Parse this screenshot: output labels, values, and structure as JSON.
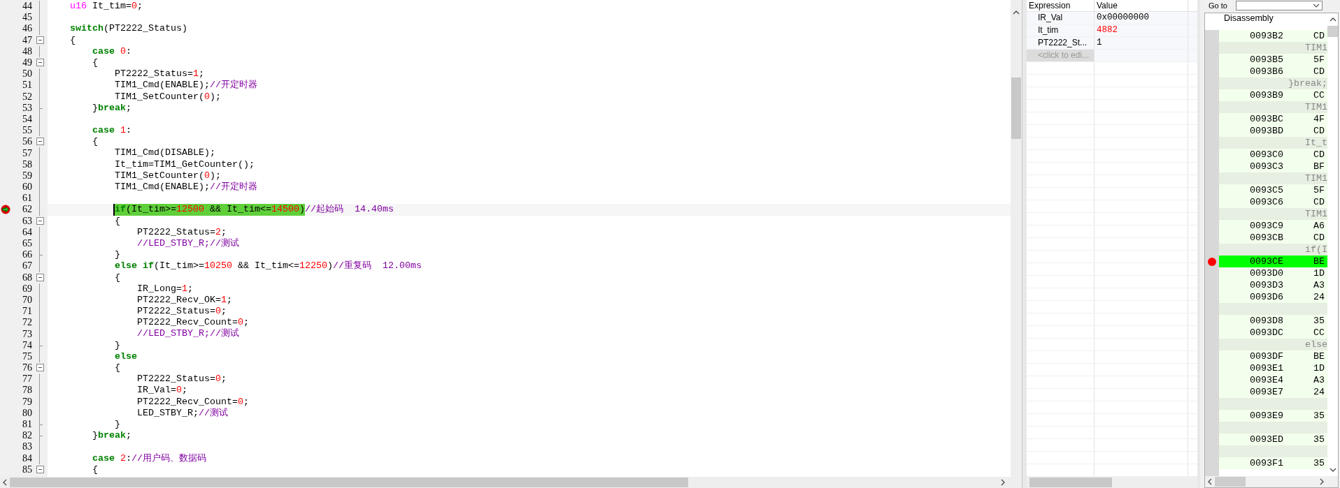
{
  "editor": {
    "lines": [
      {
        "number": "44",
        "foldable": false,
        "fold_end": false,
        "current": false,
        "tokens": [
          {
            "text": "u16",
            "kind": "type"
          },
          {
            "text": " It_tim=",
            "kind": "plain"
          },
          {
            "text": "0",
            "kind": "number"
          },
          {
            "text": ";",
            "kind": "plain"
          }
        ]
      },
      {
        "number": "45",
        "foldable": false,
        "fold_end": false,
        "current": false
      },
      {
        "number": "46",
        "foldable": false,
        "fold_end": false,
        "current": false,
        "tokens": [
          {
            "text": "switch",
            "kind": "keyword"
          },
          {
            "text": "(PT2222_Status)",
            "kind": "plain"
          }
        ]
      },
      {
        "number": "47",
        "foldable": true,
        "fold_end": false,
        "current": false,
        "tokens": [
          {
            "text": "{",
            "kind": "plain"
          }
        ],
        "children": [
          {
            "number": "48",
            "foldable": false,
            "fold_end": false,
            "current": false,
            "tokens": [
              {
                "text": "case ",
                "kind": "keyword"
              },
              {
                "text": "0",
                "kind": "number"
              },
              {
                "text": ":",
                "kind": "plain"
              }
            ]
          },
          {
            "number": "49",
            "foldable": true,
            "fold_end": false,
            "current": false,
            "tokens": [
              {
                "text": "{",
                "kind": "plain"
              }
            ],
            "children": [
              {
                "number": "50",
                "foldable": false,
                "fold_end": false,
                "current": false,
                "tokens": [
                  {
                    "text": "PT2222_Status=",
                    "kind": "plain"
                  },
                  {
                    "text": "1",
                    "kind": "number"
                  },
                  {
                    "text": ";",
                    "kind": "plain"
                  }
                ]
              },
              {
                "number": "51",
                "foldable": false,
                "fold_end": false,
                "current": false,
                "tokens": [
                  {
                    "text": "TIM1_Cmd(ENABLE);",
                    "kind": "plain"
                  },
                  {
                    "text": "//开定时器",
                    "kind": "comment"
                  }
                ]
              },
              {
                "number": "52",
                "foldable": false,
                "fold_end": false,
                "current": false,
                "tokens": [
                  {
                    "text": "TIM1_SetCounter(",
                    "kind": "plain"
                  },
                  {
                    "text": "0",
                    "kind": "number"
                  },
                  {
                    "text": ");",
                    "kind": "plain"
                  }
                ]
              }
            ]
          },
          {
            "number": "53",
            "foldable": false,
            "fold_end": true,
            "current": false,
            "tokens": [
              {
                "text": "}",
                "kind": "plain"
              },
              {
                "text": "break",
                "kind": "keyword"
              },
              {
                "text": ";",
                "kind": "plain"
              }
            ]
          },
          {
            "number": "54",
            "foldable": false,
            "fold_end": false,
            "current": false
          },
          {
            "number": "55",
            "foldable": false,
            "fold_end": false,
            "current": false,
            "tokens": [
              {
                "text": "case ",
                "kind": "keyword"
              },
              {
                "text": "1",
                "kind": "number"
              },
              {
                "text": ":",
                "kind": "plain"
              }
            ]
          },
          {
            "number": "56",
            "foldable": true,
            "fold_end": false,
            "current": false,
            "tokens": [
              {
                "text": "{",
                "kind": "plain"
              }
            ],
            "children": [
              {
                "number": "57",
                "foldable": false,
                "fold_end": false,
                "current": false,
                "tokens": [
                  {
                    "text": "TIM1_Cmd(DISABLE);",
                    "kind": "plain"
                  }
                ]
              },
              {
                "number": "58",
                "foldable": false,
                "fold_end": false,
                "current": false,
                "tokens": [
                  {
                    "text": "It_tim=TIM1_GetCounter();",
                    "kind": "plain"
                  }
                ]
              },
              {
                "number": "59",
                "foldable": false,
                "fold_end": false,
                "current": false,
                "tokens": [
                  {
                    "text": "TIM1_SetCounter(",
                    "kind": "plain"
                  },
                  {
                    "text": "0",
                    "kind": "number"
                  },
                  {
                    "text": ");",
                    "kind": "plain"
                  }
                ]
              },
              {
                "number": "60",
                "foldable": false,
                "fold_end": false,
                "current": false,
                "tokens": [
                  {
                    "text": "TIM1_Cmd(ENABLE);",
                    "kind": "plain"
                  },
                  {
                    "text": "//开定时器",
                    "kind": "comment"
                  }
                ]
              },
              {
                "number": "61",
                "foldable": false,
                "fold_end": false,
                "current": false
              },
              {
                "number": "62",
                "foldable": false,
                "fold_end": false,
                "current": true,
                "statement": [
                  {
                    "text": "if",
                    "kind": "keyword"
                  },
                  {
                    "text": "(It_tim>=",
                    "kind": "plain"
                  },
                  {
                    "text": "12500",
                    "kind": "number"
                  },
                  {
                    "text": " && It_tim<=",
                    "kind": "plain"
                  },
                  {
                    "text": "14500",
                    "kind": "number"
                  },
                  {
                    "text": ")",
                    "kind": "plain"
                  }
                ],
                "after": [
                  {
                    "text": "//起始码  14.40ms",
                    "kind": "comment"
                  }
                ]
              },
              {
                "number": "63",
                "foldable": true,
                "fold_end": false,
                "current": false,
                "tokens": [
                  {
                    "text": "{",
                    "kind": "plain"
                  }
                ],
                "children": [
                  {
                    "number": "64",
                    "foldable": false,
                    "fold_end": false,
                    "current": false,
                    "tokens": [
                      {
                        "text": "PT2222_Status=",
                        "kind": "plain"
                      },
                      {
                        "text": "2",
                        "kind": "number"
                      },
                      {
                        "text": ";",
                        "kind": "plain"
                      }
                    ]
                  },
                  {
                    "number": "65",
                    "foldable": false,
                    "fold_end": false,
                    "current": false,
                    "tokens": [
                      {
                        "text": "//LED_STBY_R;//测试",
                        "kind": "comment"
                      }
                    ]
                  }
                ]
              },
              {
                "number": "66",
                "foldable": false,
                "fold_end": true,
                "current": false,
                "tokens": [
                  {
                    "text": "}",
                    "kind": "plain"
                  }
                ]
              },
              {
                "number": "67",
                "foldable": false,
                "fold_end": false,
                "current": false,
                "tokens": [
                  {
                    "text": "else if",
                    "kind": "keyword"
                  },
                  {
                    "text": "(It_tim>=",
                    "kind": "plain"
                  },
                  {
                    "text": "10250",
                    "kind": "number"
                  },
                  {
                    "text": " && It_tim<=",
                    "kind": "plain"
                  },
                  {
                    "text": "12250",
                    "kind": "number"
                  },
                  {
                    "text": ")",
                    "kind": "plain"
                  },
                  {
                    "text": "//重复码  12.00ms",
                    "kind": "comment"
                  }
                ]
              },
              {
                "number": "68",
                "foldable": true,
                "fold_end": false,
                "current": false,
                "tokens": [
                  {
                    "text": "{",
                    "kind": "plain"
                  }
                ],
                "children": [
                  {
                    "number": "69",
                    "foldable": false,
                    "fold_end": false,
                    "current": false,
                    "tokens": [
                      {
                        "text": "IR_Long=",
                        "kind": "plain"
                      },
                      {
                        "text": "1",
                        "kind": "number"
                      },
                      {
                        "text": ";",
                        "kind": "plain"
                      }
                    ]
                  },
                  {
                    "number": "70",
                    "foldable": false,
                    "fold_end": false,
                    "current": false,
                    "tokens": [
                      {
                        "text": "PT2222_Recv_OK=",
                        "kind": "plain"
                      },
                      {
                        "text": "1",
                        "kind": "number"
                      },
                      {
                        "text": ";",
                        "kind": "plain"
                      }
                    ]
                  },
                  {
                    "number": "71",
                    "foldable": false,
                    "fold_end": false,
                    "current": false,
                    "tokens": [
                      {
                        "text": "PT2222_Status=",
                        "kind": "plain"
                      },
                      {
                        "text": "0",
                        "kind": "number"
                      },
                      {
                        "text": ";",
                        "kind": "plain"
                      }
                    ]
                  },
                  {
                    "number": "72",
                    "foldable": false,
                    "fold_end": false,
                    "current": false,
                    "tokens": [
                      {
                        "text": "PT2222_Recv_Count=",
                        "kind": "plain"
                      },
                      {
                        "text": "0",
                        "kind": "number"
                      },
                      {
                        "text": ";",
                        "kind": "plain"
                      }
                    ]
                  },
                  {
                    "number": "73",
                    "foldable": false,
                    "fold_end": false,
                    "current": false,
                    "tokens": [
                      {
                        "text": "//LED_STBY_R;//测试",
                        "kind": "comment"
                      }
                    ]
                  }
                ]
              },
              {
                "number": "74",
                "foldable": false,
                "fold_end": true,
                "current": false,
                "tokens": [
                  {
                    "text": "}",
                    "kind": "plain"
                  }
                ]
              },
              {
                "number": "75",
                "foldable": false,
                "fold_end": false,
                "current": false,
                "tokens": [
                  {
                    "text": "else",
                    "kind": "keyword"
                  }
                ]
              },
              {
                "number": "76",
                "foldable": true,
                "fold_end": false,
                "current": false,
                "tokens": [
                  {
                    "text": "{",
                    "kind": "plain"
                  }
                ],
                "children": [
                  {
                    "number": "77",
                    "foldable": false,
                    "fold_end": false,
                    "current": false,
                    "tokens": [
                      {
                        "text": "PT2222_Status=",
                        "kind": "plain"
                      },
                      {
                        "text": "0",
                        "kind": "number"
                      },
                      {
                        "text": ";",
                        "kind": "plain"
                      }
                    ]
                  },
                  {
                    "number": "78",
                    "foldable": false,
                    "fold_end": false,
                    "current": false,
                    "tokens": [
                      {
                        "text": "IR_Val=",
                        "kind": "plain"
                      },
                      {
                        "text": "0",
                        "kind": "number"
                      },
                      {
                        "text": ";",
                        "kind": "plain"
                      }
                    ]
                  },
                  {
                    "number": "79",
                    "foldable": false,
                    "fold_end": false,
                    "current": false,
                    "tokens": [
                      {
                        "text": "PT2222_Recv_Count=",
                        "kind": "plain"
                      },
                      {
                        "text": "0",
                        "kind": "number"
                      },
                      {
                        "text": ";",
                        "kind": "plain"
                      }
                    ]
                  },
                  {
                    "number": "80",
                    "foldable": false,
                    "fold_end": false,
                    "current": false,
                    "tokens": [
                      {
                        "text": "LED_STBY_R;",
                        "kind": "plain"
                      },
                      {
                        "text": "//测试",
                        "kind": "comment"
                      }
                    ]
                  }
                ]
              },
              {
                "number": "81",
                "foldable": false,
                "fold_end": true,
                "current": false,
                "tokens": [
                  {
                    "text": "}",
                    "kind": "plain"
                  }
                ]
              }
            ]
          },
          {
            "number": "82",
            "foldable": false,
            "fold_end": true,
            "current": false,
            "tokens": [
              {
                "text": "}",
                "kind": "plain"
              },
              {
                "text": "break",
                "kind": "keyword"
              },
              {
                "text": ";",
                "kind": "plain"
              }
            ]
          },
          {
            "number": "83",
            "foldable": false,
            "fold_end": false,
            "current": false
          },
          {
            "number": "84",
            "foldable": false,
            "fold_end": false,
            "current": false,
            "tokens": [
              {
                "text": "case ",
                "kind": "keyword"
              },
              {
                "text": "2",
                "kind": "number"
              },
              {
                "text": ":",
                "kind": "plain"
              },
              {
                "text": "//用户码、数据码",
                "kind": "comment"
              }
            ]
          },
          {
            "number": "85",
            "foldable": true,
            "fold_end": false,
            "current": false,
            "tokens": [
              {
                "text": "{",
                "kind": "plain"
              }
            ]
          }
        ]
      }
    ]
  },
  "watch": {
    "columns": [
      "Expression",
      "Value"
    ],
    "rows": [
      {
        "expression": "IR_Val",
        "value": "0x00000000",
        "changed": false
      },
      {
        "expression": "It_tim",
        "value": "4882",
        "changed": true
      },
      {
        "expression": "PT2222_St...",
        "value": "1",
        "changed": false
      }
    ],
    "placeholder": "<click to edi..."
  },
  "disassembly": {
    "goto_label": "Go to",
    "title": "Disassembly",
    "rows": [
      {
        "kind": "code",
        "address": "0093B2",
        "opcode": "CD",
        "current": false,
        "breakpoint": false
      },
      {
        "kind": "source",
        "text": "TIM1",
        "current": false,
        "breakpoint": false
      },
      {
        "kind": "code",
        "address": "0093B5",
        "opcode": "5F",
        "current": false,
        "breakpoint": false
      },
      {
        "kind": "code",
        "address": "0093B6",
        "opcode": "CD",
        "current": false,
        "breakpoint": false
      },
      {
        "kind": "source",
        "text": "}break;",
        "current": false,
        "breakpoint": false
      },
      {
        "kind": "code",
        "address": "0093B9",
        "opcode": "CC",
        "current": false,
        "breakpoint": false
      },
      {
        "kind": "source",
        "text": "TIM1",
        "current": false,
        "breakpoint": false
      },
      {
        "kind": "code",
        "address": "0093BC",
        "opcode": "4F",
        "current": false,
        "breakpoint": false
      },
      {
        "kind": "code",
        "address": "0093BD",
        "opcode": "CD",
        "current": false,
        "breakpoint": false
      },
      {
        "kind": "source",
        "text": "It_t",
        "current": false,
        "breakpoint": false
      },
      {
        "kind": "code",
        "address": "0093C0",
        "opcode": "CD",
        "current": false,
        "breakpoint": false
      },
      {
        "kind": "code",
        "address": "0093C3",
        "opcode": "BF",
        "current": false,
        "breakpoint": false
      },
      {
        "kind": "source",
        "text": "TIM1",
        "current": false,
        "breakpoint": false
      },
      {
        "kind": "code",
        "address": "0093C5",
        "opcode": "5F",
        "current": false,
        "breakpoint": false
      },
      {
        "kind": "code",
        "address": "0093C6",
        "opcode": "CD",
        "current": false,
        "breakpoint": false
      },
      {
        "kind": "source",
        "text": "TIM1",
        "current": false,
        "breakpoint": false
      },
      {
        "kind": "code",
        "address": "0093C9",
        "opcode": "A6",
        "current": false,
        "breakpoint": false
      },
      {
        "kind": "code",
        "address": "0093CB",
        "opcode": "CD",
        "current": false,
        "breakpoint": false
      },
      {
        "kind": "source",
        "text": "if(I",
        "current": false,
        "breakpoint": false
      },
      {
        "kind": "code",
        "address": "0093CE",
        "opcode": "BE",
        "current": true,
        "breakpoint": true
      },
      {
        "kind": "code",
        "address": "0093D0",
        "opcode": "1D",
        "current": false,
        "breakpoint": false
      },
      {
        "kind": "code",
        "address": "0093D3",
        "opcode": "A3",
        "current": false,
        "breakpoint": false
      },
      {
        "kind": "code",
        "address": "0093D6",
        "opcode": "24",
        "current": false,
        "breakpoint": false
      },
      {
        "kind": "source",
        "current": false,
        "breakpoint": false
      },
      {
        "kind": "code",
        "address": "0093D8",
        "opcode": "35",
        "current": false,
        "breakpoint": false
      },
      {
        "kind": "code",
        "address": "0093DC",
        "opcode": "CC",
        "current": false,
        "breakpoint": false
      },
      {
        "kind": "source",
        "text": "else",
        "current": false,
        "breakpoint": false
      },
      {
        "kind": "code",
        "address": "0093DF",
        "opcode": "BE",
        "current": false,
        "breakpoint": false
      },
      {
        "kind": "code",
        "address": "0093E1",
        "opcode": "1D",
        "current": false,
        "breakpoint": false
      },
      {
        "kind": "code",
        "address": "0093E4",
        "opcode": "A3",
        "current": false,
        "breakpoint": false
      },
      {
        "kind": "code",
        "address": "0093E7",
        "opcode": "24",
        "current": false,
        "breakpoint": false
      },
      {
        "kind": "source",
        "current": false,
        "breakpoint": false
      },
      {
        "kind": "code",
        "address": "0093E9",
        "opcode": "35",
        "current": false,
        "breakpoint": false
      },
      {
        "kind": "source",
        "current": false,
        "breakpoint": false
      },
      {
        "kind": "code",
        "address": "0093ED",
        "opcode": "35",
        "current": false,
        "breakpoint": false
      },
      {
        "kind": "source",
        "current": false,
        "breakpoint": false
      },
      {
        "kind": "code",
        "address": "0093F1",
        "opcode": "35",
        "current": false,
        "breakpoint": false
      }
    ]
  }
}
